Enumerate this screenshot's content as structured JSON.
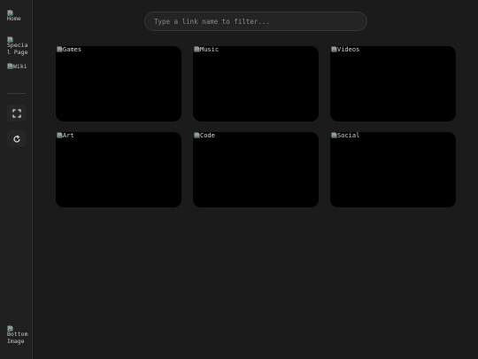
{
  "sidebar": {
    "items": [
      {
        "label": "Home",
        "icon": "broken-image-icon"
      },
      {
        "label": "Special Page",
        "icon": "broken-image-icon"
      },
      {
        "label": "Wiki",
        "icon": "broken-image-icon"
      }
    ],
    "buttons": [
      {
        "icon": "fullscreen-icon"
      },
      {
        "icon": "refresh-icon"
      }
    ],
    "bottom_item": {
      "label": "Bottom Image",
      "icon": "broken-image-icon"
    }
  },
  "search": {
    "placeholder": "Type a link name to filter...",
    "value": ""
  },
  "cards": [
    {
      "label": "Games"
    },
    {
      "label": "Music"
    },
    {
      "label": "Videos"
    },
    {
      "label": "Art"
    },
    {
      "label": "Code"
    },
    {
      "label": "Social"
    }
  ],
  "colors": {
    "background": "#1b1b1b",
    "sidebar": "#202020",
    "card": "#000000",
    "text": "#d8d8d8"
  }
}
